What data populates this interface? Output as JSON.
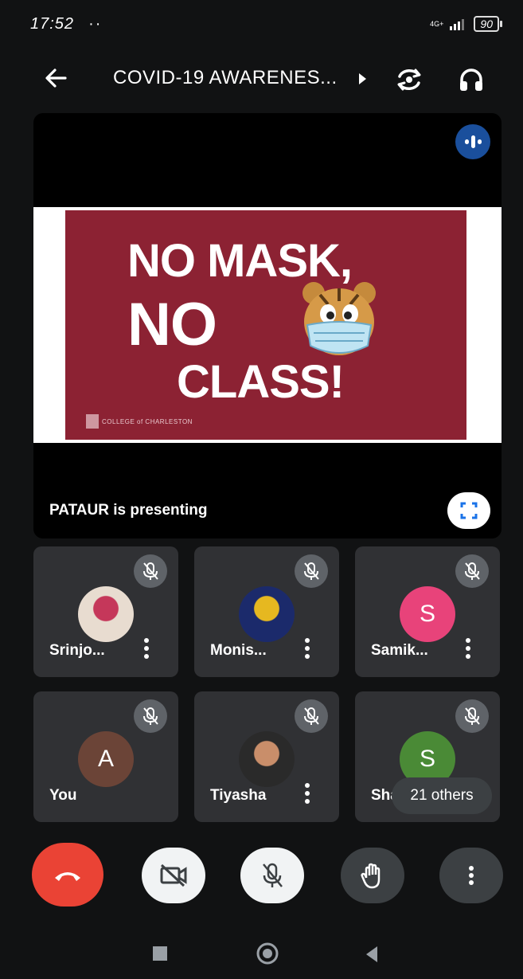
{
  "status_bar": {
    "time": "17:52",
    "dots": "··",
    "network": "4G+",
    "battery": "90"
  },
  "header": {
    "title": "COVID-19 AWARENES..."
  },
  "presentation": {
    "slide_lines": [
      "NO MASK,",
      "NO",
      "CLASS!"
    ],
    "slide_logo_text": "COLLEGE of CHARLESTON",
    "presenting_text": "PATAUR is presenting"
  },
  "participants": [
    {
      "name": "Srinjo...",
      "avatar_type": "photo",
      "photo_colors": [
        "#e8dcd0",
        "#c5375a"
      ]
    },
    {
      "name": "Monis...",
      "avatar_type": "photo",
      "photo_colors": [
        "#1b2a6b",
        "#e6b820"
      ]
    },
    {
      "name": "Samik...",
      "avatar_type": "letter",
      "letter": "S",
      "color": "#e8437a"
    },
    {
      "name": "You",
      "avatar_type": "letter",
      "letter": "A",
      "color": "#6b4437"
    },
    {
      "name": "Tiyasha",
      "avatar_type": "photo",
      "photo_colors": [
        "#2a2a2a",
        "#c98e6a"
      ]
    },
    {
      "name": "Shar",
      "avatar_type": "letter",
      "letter": "S",
      "color": "#4a8a36"
    }
  ],
  "others_label": "21 others",
  "colors": {
    "end_call": "#ea4335",
    "slide_bg": "#8c2233",
    "speaking": "#1a4f9c"
  }
}
